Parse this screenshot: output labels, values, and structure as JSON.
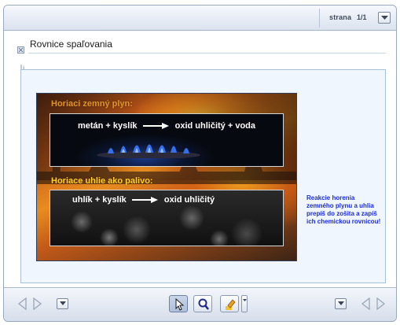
{
  "header": {
    "page_label": "strana",
    "page_number": "1/1"
  },
  "content": {
    "title": "Rovnice spaľovania",
    "slide": {
      "heading_gas": "Horiaci zemný plyn:",
      "equation_gas": {
        "left": "metán + kyslík",
        "right": "oxid uhličitý + voda"
      },
      "heading_coal": "Horiace uhlie ako palivo:",
      "equation_coal": {
        "left": "uhlík + kyslík",
        "right": "oxid uhličitý"
      }
    },
    "note": "Reakcie horenia zemného plynu a uhlia prepíš do zošita a zapíš ich chemickou rovnicou!"
  },
  "colors": {
    "note_text": "#1d2dd6",
    "slide_heading": "#ffd22b",
    "frame_border": "#9aa8bd"
  },
  "toolbar": {
    "icons": [
      "arrow-left-icon",
      "arrow-right-icon",
      "dropdown-icon",
      "pointer-icon",
      "zoom-icon",
      "highlighter-icon",
      "dropdown-icon",
      "arrow-left-icon",
      "arrow-right-icon"
    ]
  }
}
